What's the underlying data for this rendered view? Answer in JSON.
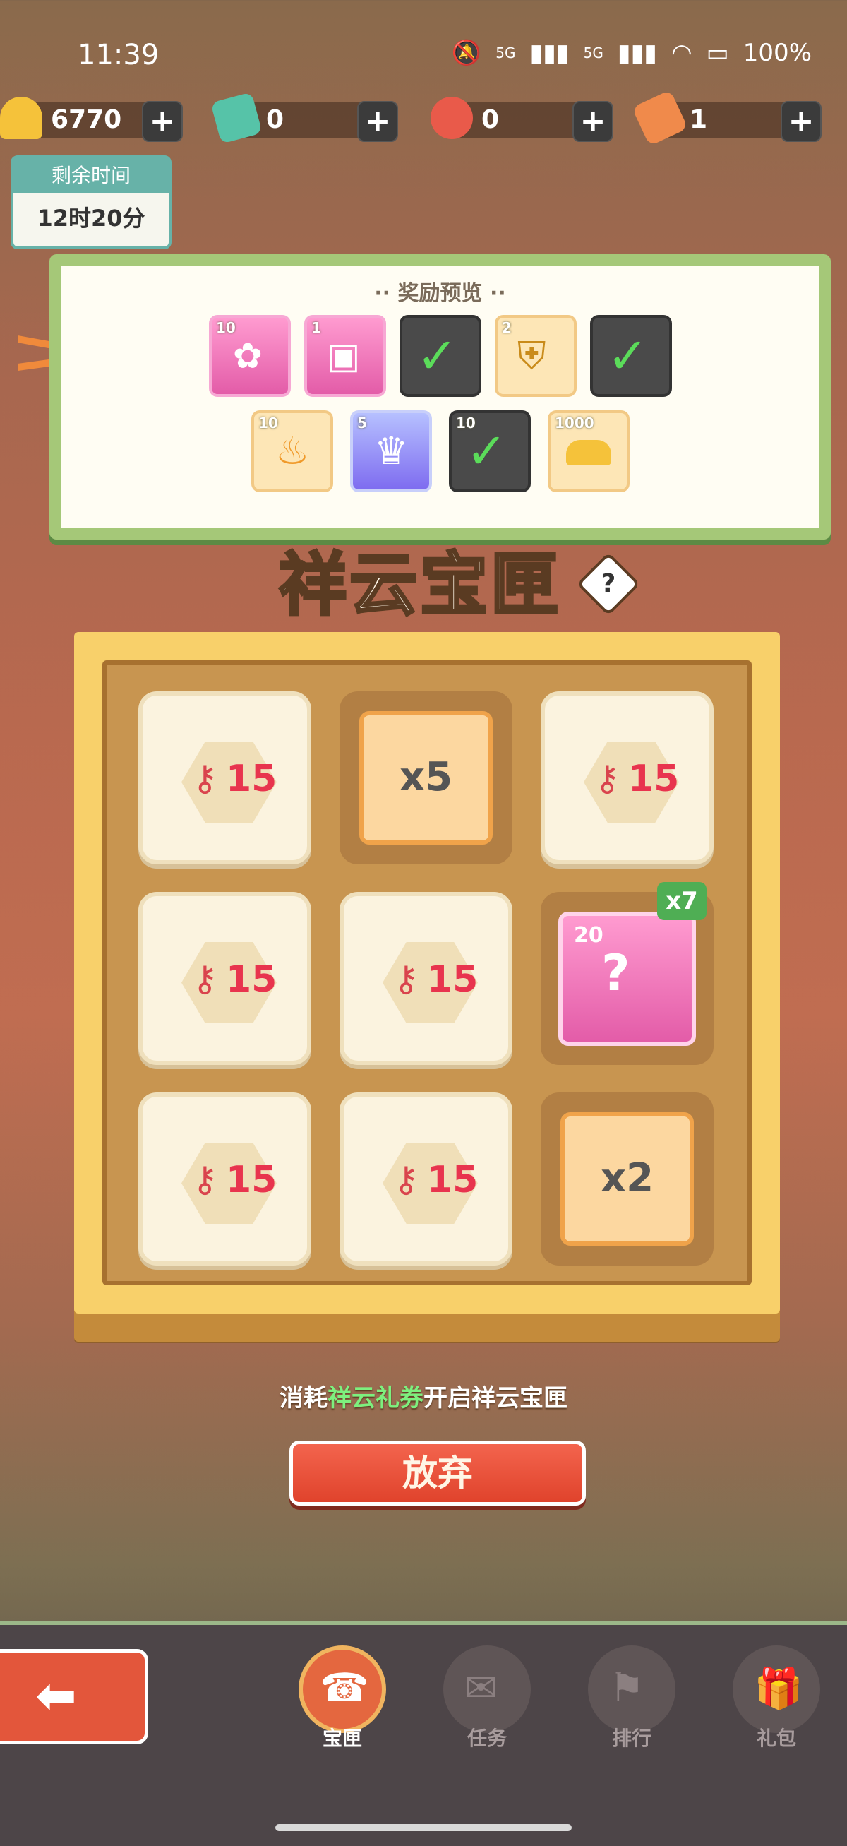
{
  "status": {
    "time": "11:39",
    "signal1": "5G",
    "signal2": "5G",
    "battery": "100%"
  },
  "currency": [
    {
      "icon": "gold-ingot-icon",
      "value": "6770"
    },
    {
      "icon": "ticket-card-icon",
      "value": "0"
    },
    {
      "icon": "key-icon",
      "value": "0"
    },
    {
      "icon": "voucher-icon",
      "value": "1"
    }
  ],
  "timer": {
    "label": "剩余时间",
    "value": "12时20分"
  },
  "reward": {
    "title": "奖励预览",
    "items": [
      {
        "count": "10",
        "style": "pink",
        "claimed": false,
        "icon": "flame-fragment-icon"
      },
      {
        "count": "1",
        "style": "pink",
        "claimed": false,
        "icon": "character-pack-icon"
      },
      {
        "count": "",
        "style": "dark",
        "claimed": true,
        "icon": "check-icon"
      },
      {
        "count": "2",
        "style": "gold",
        "claimed": false,
        "icon": "general-shield-icon"
      },
      {
        "count": "",
        "style": "dark",
        "claimed": true,
        "icon": "check-icon"
      },
      {
        "count": "10",
        "style": "gold",
        "claimed": false,
        "icon": "fire-icon"
      },
      {
        "count": "5",
        "style": "purple",
        "claimed": false,
        "icon": "crest-icon"
      },
      {
        "count": "10",
        "style": "dark",
        "claimed": true,
        "icon": "check-icon"
      },
      {
        "count": "1000",
        "style": "gold",
        "claimed": false,
        "icon": "gold-ingot-icon"
      }
    ]
  },
  "box_title": "祥云宝匣",
  "grid": [
    {
      "type": "key",
      "value": "15"
    },
    {
      "type": "mult",
      "value": "x5"
    },
    {
      "type": "key",
      "value": "15"
    },
    {
      "type": "key",
      "value": "15"
    },
    {
      "type": "key",
      "value": "15"
    },
    {
      "type": "card",
      "count": "20",
      "badge": "x7"
    },
    {
      "type": "key",
      "value": "15"
    },
    {
      "type": "key",
      "value": "15"
    },
    {
      "type": "mult",
      "value": "x2"
    }
  ],
  "consume": {
    "prefix": "消耗",
    "highlight": "祥云礼券",
    "suffix": "开启祥云宝匣"
  },
  "abandon_label": "放弃",
  "nav": [
    {
      "label": "宝匣",
      "icon": "treasure-box-icon",
      "active": true
    },
    {
      "label": "任务",
      "icon": "scroll-icon",
      "active": false
    },
    {
      "label": "排行",
      "icon": "banner-icon",
      "active": false
    },
    {
      "label": "礼包",
      "icon": "gift-icon",
      "active": false
    }
  ]
}
